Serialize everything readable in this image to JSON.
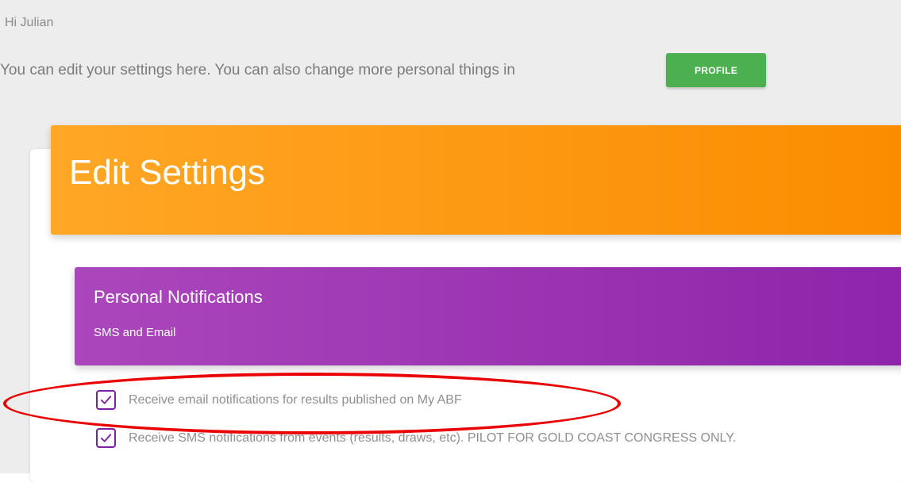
{
  "greeting": "Hi Julian",
  "intro_text": "You can edit your settings here. You can also change more personal things in",
  "profile_button_label": "PROFILE",
  "page_title": "Edit Settings",
  "section": {
    "title": "Personal Notifications",
    "subtitle": "SMS and Email"
  },
  "options": [
    {
      "label": "Receive email notifications for results published on My ABF",
      "checked": true
    },
    {
      "label": "Receive SMS notifications from events (results, draws, etc). PILOT FOR GOLD COAST CONGRESS ONLY.",
      "checked": true
    }
  ],
  "colors": {
    "profile_button": "#4caf50",
    "header_orange": "#ffa726",
    "header_purple": "#ab47bc",
    "checkbox_border": "#7b1fa2",
    "annotation_oval": "#ea0000"
  },
  "icons": {
    "checkbox": "check-icon"
  }
}
